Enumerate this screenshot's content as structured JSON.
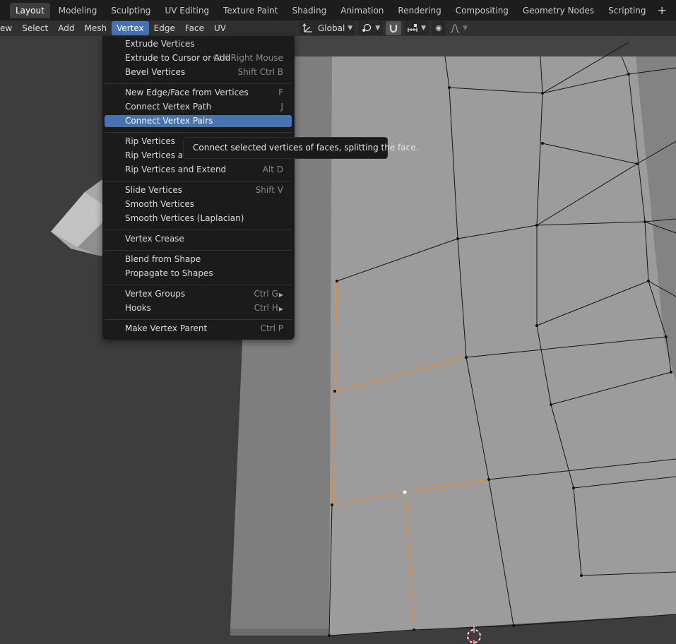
{
  "workspace_tabs": [
    "Layout",
    "Modeling",
    "Sculpting",
    "UV Editing",
    "Texture Paint",
    "Shading",
    "Animation",
    "Rendering",
    "Compositing",
    "Geometry Nodes",
    "Scripting"
  ],
  "add_workspace_label": "+",
  "header_menus": [
    "ew",
    "Select",
    "Add",
    "Mesh",
    "Vertex",
    "Edge",
    "Face",
    "UV"
  ],
  "open_menu": "Vertex",
  "transform_orientation": "Global",
  "vertex_menu": {
    "groups": [
      [
        {
          "label": "Extrude Vertices",
          "shortcut": ""
        },
        {
          "label": "Extrude to Cursor or Add",
          "shortcut": "Ctrl Right Mouse"
        },
        {
          "label": "Bevel Vertices",
          "shortcut": "Shift Ctrl B"
        }
      ],
      [
        {
          "label": "New Edge/Face from Vertices",
          "shortcut": "F"
        },
        {
          "label": "Connect Vertex Path",
          "shortcut": "J"
        },
        {
          "label": "Connect Vertex Pairs",
          "shortcut": "",
          "highlighted": true
        }
      ],
      [
        {
          "label": "Rip Vertices",
          "shortcut": ""
        },
        {
          "label": "Rip Vertices and",
          "shortcut": ""
        },
        {
          "label": "Rip Vertices and Extend",
          "shortcut": "Alt D"
        }
      ],
      [
        {
          "label": "Slide Vertices",
          "shortcut": "Shift V"
        },
        {
          "label": "Smooth Vertices",
          "shortcut": ""
        },
        {
          "label": "Smooth Vertices (Laplacian)",
          "shortcut": ""
        }
      ],
      [
        {
          "label": "Vertex Crease",
          "shortcut": ""
        }
      ],
      [
        {
          "label": "Blend from Shape",
          "shortcut": ""
        },
        {
          "label": "Propagate to Shapes",
          "shortcut": ""
        }
      ],
      [
        {
          "label": "Vertex Groups",
          "shortcut": "Ctrl G",
          "submenu": true
        },
        {
          "label": "Hooks",
          "shortcut": "Ctrl H",
          "submenu": true
        }
      ],
      [
        {
          "label": "Make Vertex Parent",
          "shortcut": "Ctrl P"
        }
      ]
    ]
  },
  "tooltip": "Connect selected vertices of faces, splitting the face.",
  "colors": {
    "accent": "#4772b3",
    "selected_edge": "#e8892e",
    "menu_bg": "#1b1b1b",
    "mesh_face": "#9b9b9b"
  }
}
